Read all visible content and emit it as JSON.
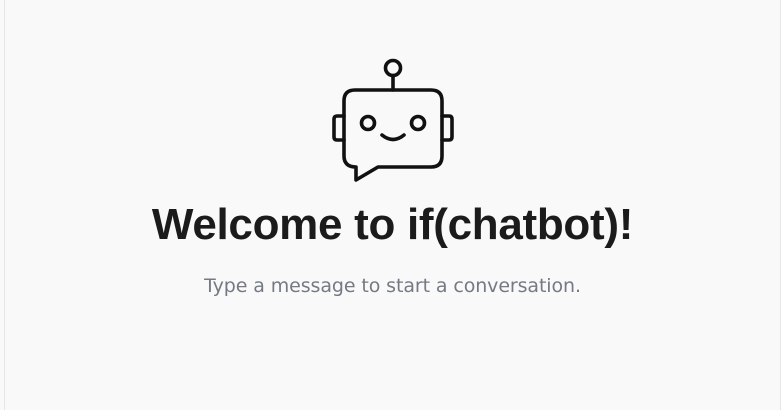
{
  "welcome": {
    "icon": "robot-chat-icon",
    "title": "Welcome to if(chatbot)!",
    "subtitle": "Type a message to start a conversation."
  },
  "colors": {
    "background": "#f9f9f9",
    "title": "#1b1b1b",
    "subtitle": "#747984",
    "icon_stroke": "#111111"
  }
}
